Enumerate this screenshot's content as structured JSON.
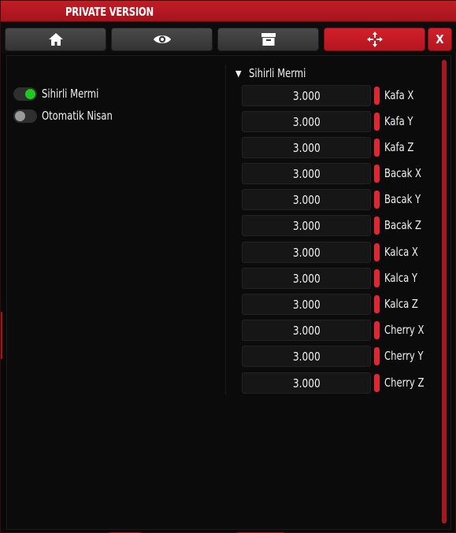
{
  "window": {
    "title": "PRIVATE VERSION"
  },
  "tabs": [
    {
      "icon": "home-icon",
      "active": false
    },
    {
      "icon": "eye-icon",
      "active": false
    },
    {
      "icon": "archive-box-icon",
      "active": false
    },
    {
      "icon": "move-crosshair-icon",
      "active": true
    }
  ],
  "close_label": "X",
  "toggles": [
    {
      "label": "Sihirli Mermi",
      "on": true
    },
    {
      "label": "Otomatik Nisan",
      "on": false
    }
  ],
  "section": {
    "title": "Sihirli Mermi",
    "fields": [
      {
        "value": "3.000",
        "label": "Kafa X"
      },
      {
        "value": "3.000",
        "label": "Kafa Y"
      },
      {
        "value": "3.000",
        "label": "Kafa Z"
      },
      {
        "value": "3.000",
        "label": "Bacak X"
      },
      {
        "value": "3.000",
        "label": "Bacak Y"
      },
      {
        "value": "3.000",
        "label": "Bacak Z"
      },
      {
        "value": "3.000",
        "label": "Kalca X"
      },
      {
        "value": "3.000",
        "label": "Kalca Y"
      },
      {
        "value": "3.000",
        "label": "Kalca Z"
      },
      {
        "value": "3.000",
        "label": "Cherry X"
      },
      {
        "value": "3.000",
        "label": "Cherry Y"
      },
      {
        "value": "3.000",
        "label": "Cherry Z"
      }
    ]
  },
  "colors": {
    "accent": "#c21d26",
    "toggle_on": "#1ec81e",
    "toggle_off": "#9a9a9a"
  }
}
